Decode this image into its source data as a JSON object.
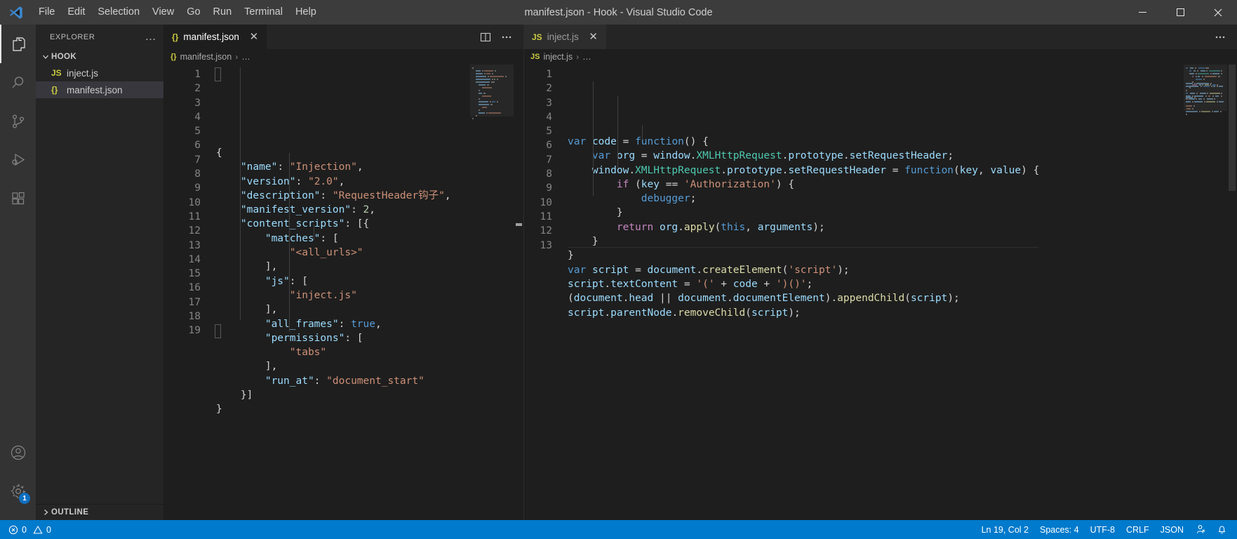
{
  "window": {
    "title": "manifest.json - Hook - Visual Studio Code",
    "logo": "vscode-logo",
    "controls": {
      "minimize": "minimize-icon",
      "maximize": "maximize-icon",
      "close": "close-icon"
    }
  },
  "menubar": {
    "items": [
      {
        "label": "File"
      },
      {
        "label": "Edit"
      },
      {
        "label": "Selection"
      },
      {
        "label": "View"
      },
      {
        "label": "Go"
      },
      {
        "label": "Run"
      },
      {
        "label": "Terminal"
      },
      {
        "label": "Help"
      }
    ]
  },
  "activitybar": {
    "items": [
      {
        "name": "explorer",
        "icon": "files-icon",
        "active": true
      },
      {
        "name": "search",
        "icon": "search-icon",
        "active": false
      },
      {
        "name": "source-control",
        "icon": "source-control-icon",
        "active": false
      },
      {
        "name": "run-and-debug",
        "icon": "run-debug-icon",
        "active": false
      },
      {
        "name": "extensions",
        "icon": "extensions-icon",
        "active": false
      }
    ],
    "bottom": [
      {
        "name": "accounts",
        "icon": "account-icon",
        "badge": ""
      },
      {
        "name": "manage",
        "icon": "gear-icon",
        "badge": "1"
      }
    ]
  },
  "sidebar": {
    "title": "EXPLORER",
    "more_actions": "…",
    "folder": {
      "label": "HOOK",
      "expanded": true
    },
    "files": [
      {
        "label": "inject.js",
        "icon": "JS",
        "icon_type": "js",
        "selected": false
      },
      {
        "label": "manifest.json",
        "icon": "{}",
        "icon_type": "json",
        "selected": true
      }
    ],
    "outline": {
      "label": "OUTLINE",
      "expanded": false
    }
  },
  "editors": [
    {
      "id": "left",
      "tab": {
        "label": "manifest.json",
        "icon": "{}",
        "close": "✕",
        "active": true
      },
      "actions": [
        {
          "name": "split-editor-button",
          "icon": "split-editor-icon"
        },
        {
          "name": "editor-more-actions-button",
          "icon": "ellipsis-icon"
        }
      ],
      "breadcrumb": {
        "icon": "{}",
        "file": "manifest.json",
        "separator": "›",
        "trail": "…"
      },
      "line_count": 19,
      "code": [
        [
          {
            "t": "punc",
            "v": "{"
          }
        ],
        [
          {
            "t": "plain",
            "v": "    "
          },
          {
            "t": "key",
            "v": "\"name\""
          },
          {
            "t": "punc",
            "v": ": "
          },
          {
            "t": "str",
            "v": "\"Injection\""
          },
          {
            "t": "punc",
            "v": ","
          }
        ],
        [
          {
            "t": "plain",
            "v": "    "
          },
          {
            "t": "key",
            "v": "\"version\""
          },
          {
            "t": "punc",
            "v": ": "
          },
          {
            "t": "str",
            "v": "\"2.0\""
          },
          {
            "t": "punc",
            "v": ","
          }
        ],
        [
          {
            "t": "plain",
            "v": "    "
          },
          {
            "t": "key",
            "v": "\"description\""
          },
          {
            "t": "punc",
            "v": ": "
          },
          {
            "t": "str",
            "v": "\"RequestHeader钩子\""
          },
          {
            "t": "punc",
            "v": ","
          }
        ],
        [
          {
            "t": "plain",
            "v": "    "
          },
          {
            "t": "key",
            "v": "\"manifest_version\""
          },
          {
            "t": "punc",
            "v": ": "
          },
          {
            "t": "num",
            "v": "2"
          },
          {
            "t": "punc",
            "v": ","
          }
        ],
        [
          {
            "t": "plain",
            "v": "    "
          },
          {
            "t": "key",
            "v": "\"content_scripts\""
          },
          {
            "t": "punc",
            "v": ": [{"
          }
        ],
        [
          {
            "t": "plain",
            "v": "        "
          },
          {
            "t": "key",
            "v": "\"matches\""
          },
          {
            "t": "punc",
            "v": ": ["
          }
        ],
        [
          {
            "t": "plain",
            "v": "            "
          },
          {
            "t": "str",
            "v": "\"<all_urls>\""
          }
        ],
        [
          {
            "t": "plain",
            "v": "        "
          },
          {
            "t": "punc",
            "v": "],"
          }
        ],
        [
          {
            "t": "plain",
            "v": "        "
          },
          {
            "t": "key",
            "v": "\"js\""
          },
          {
            "t": "punc",
            "v": ": ["
          }
        ],
        [
          {
            "t": "plain",
            "v": "            "
          },
          {
            "t": "str",
            "v": "\"inject.js\""
          }
        ],
        [
          {
            "t": "plain",
            "v": "        "
          },
          {
            "t": "punc",
            "v": "],"
          }
        ],
        [
          {
            "t": "plain",
            "v": "        "
          },
          {
            "t": "key",
            "v": "\"all_frames\""
          },
          {
            "t": "punc",
            "v": ": "
          },
          {
            "t": "bool",
            "v": "true"
          },
          {
            "t": "punc",
            "v": ","
          }
        ],
        [
          {
            "t": "plain",
            "v": "        "
          },
          {
            "t": "key",
            "v": "\"permissions\""
          },
          {
            "t": "punc",
            "v": ": ["
          }
        ],
        [
          {
            "t": "plain",
            "v": "            "
          },
          {
            "t": "str",
            "v": "\"tabs\""
          }
        ],
        [
          {
            "t": "plain",
            "v": "        "
          },
          {
            "t": "punc",
            "v": "],"
          }
        ],
        [
          {
            "t": "plain",
            "v": "        "
          },
          {
            "t": "key",
            "v": "\"run_at\""
          },
          {
            "t": "punc",
            "v": ": "
          },
          {
            "t": "str",
            "v": "\"document_start\""
          }
        ],
        [
          {
            "t": "plain",
            "v": "    "
          },
          {
            "t": "punc",
            "v": "}]"
          }
        ],
        [
          {
            "t": "punc",
            "v": "}"
          }
        ]
      ]
    },
    {
      "id": "right",
      "tab": {
        "label": "inject.js",
        "icon": "JS",
        "close": "✕",
        "active": false
      },
      "actions": [
        {
          "name": "editor-more-actions-button",
          "icon": "ellipsis-icon"
        }
      ],
      "breadcrumb": {
        "icon": "JS",
        "file": "inject.js",
        "separator": "›",
        "trail": "…"
      },
      "line_count": 13,
      "code": [
        [
          {
            "t": "kw",
            "v": "var"
          },
          {
            "t": "plain",
            "v": " "
          },
          {
            "t": "var",
            "v": "code"
          },
          {
            "t": "plain",
            "v": " "
          },
          {
            "t": "punc",
            "v": "="
          },
          {
            "t": "plain",
            "v": " "
          },
          {
            "t": "kw",
            "v": "function"
          },
          {
            "t": "punc",
            "v": "() {"
          }
        ],
        [
          {
            "t": "plain",
            "v": "    "
          },
          {
            "t": "kw",
            "v": "var"
          },
          {
            "t": "plain",
            "v": " "
          },
          {
            "t": "var",
            "v": "org"
          },
          {
            "t": "plain",
            "v": " "
          },
          {
            "t": "punc",
            "v": "="
          },
          {
            "t": "plain",
            "v": " "
          },
          {
            "t": "var",
            "v": "window"
          },
          {
            "t": "punc",
            "v": "."
          },
          {
            "t": "cls",
            "v": "XMLHttpRequest"
          },
          {
            "t": "punc",
            "v": "."
          },
          {
            "t": "var",
            "v": "prototype"
          },
          {
            "t": "punc",
            "v": "."
          },
          {
            "t": "var",
            "v": "setRequestHeader"
          },
          {
            "t": "punc",
            "v": ";"
          }
        ],
        [
          {
            "t": "plain",
            "v": "    "
          },
          {
            "t": "var",
            "v": "window"
          },
          {
            "t": "punc",
            "v": "."
          },
          {
            "t": "cls",
            "v": "XMLHttpRequest"
          },
          {
            "t": "punc",
            "v": "."
          },
          {
            "t": "var",
            "v": "prototype"
          },
          {
            "t": "punc",
            "v": "."
          },
          {
            "t": "var",
            "v": "setRequestHeader"
          },
          {
            "t": "plain",
            "v": " "
          },
          {
            "t": "punc",
            "v": "="
          },
          {
            "t": "plain",
            "v": " "
          },
          {
            "t": "kw",
            "v": "function"
          },
          {
            "t": "punc",
            "v": "("
          },
          {
            "t": "var",
            "v": "key"
          },
          {
            "t": "punc",
            "v": ", "
          },
          {
            "t": "var",
            "v": "value"
          },
          {
            "t": "punc",
            "v": ") {"
          }
        ],
        [
          {
            "t": "plain",
            "v": "        "
          },
          {
            "t": "kw2",
            "v": "if"
          },
          {
            "t": "plain",
            "v": " "
          },
          {
            "t": "punc",
            "v": "("
          },
          {
            "t": "var",
            "v": "key"
          },
          {
            "t": "plain",
            "v": " "
          },
          {
            "t": "punc",
            "v": "=="
          },
          {
            "t": "plain",
            "v": " "
          },
          {
            "t": "str",
            "v": "'Authorization'"
          },
          {
            "t": "punc",
            "v": ") {"
          }
        ],
        [
          {
            "t": "plain",
            "v": "            "
          },
          {
            "t": "kw",
            "v": "debugger"
          },
          {
            "t": "punc",
            "v": ";"
          }
        ],
        [
          {
            "t": "plain",
            "v": "        "
          },
          {
            "t": "punc",
            "v": "}"
          }
        ],
        [
          {
            "t": "plain",
            "v": "        "
          },
          {
            "t": "kw2",
            "v": "return"
          },
          {
            "t": "plain",
            "v": " "
          },
          {
            "t": "var",
            "v": "org"
          },
          {
            "t": "punc",
            "v": "."
          },
          {
            "t": "fn",
            "v": "apply"
          },
          {
            "t": "punc",
            "v": "("
          },
          {
            "t": "kw",
            "v": "this"
          },
          {
            "t": "punc",
            "v": ", "
          },
          {
            "t": "var",
            "v": "arguments"
          },
          {
            "t": "punc",
            "v": ");"
          }
        ],
        [
          {
            "t": "plain",
            "v": "    "
          },
          {
            "t": "punc",
            "v": "}"
          }
        ],
        [
          {
            "t": "punc",
            "v": "}"
          }
        ],
        [
          {
            "t": "kw",
            "v": "var"
          },
          {
            "t": "plain",
            "v": " "
          },
          {
            "t": "var",
            "v": "script"
          },
          {
            "t": "plain",
            "v": " "
          },
          {
            "t": "punc",
            "v": "="
          },
          {
            "t": "plain",
            "v": " "
          },
          {
            "t": "var",
            "v": "document"
          },
          {
            "t": "punc",
            "v": "."
          },
          {
            "t": "fn",
            "v": "createElement"
          },
          {
            "t": "punc",
            "v": "("
          },
          {
            "t": "str",
            "v": "'script'"
          },
          {
            "t": "punc",
            "v": ");"
          }
        ],
        [
          {
            "t": "var",
            "v": "script"
          },
          {
            "t": "punc",
            "v": "."
          },
          {
            "t": "var",
            "v": "textContent"
          },
          {
            "t": "plain",
            "v": " "
          },
          {
            "t": "punc",
            "v": "="
          },
          {
            "t": "plain",
            "v": " "
          },
          {
            "t": "str",
            "v": "'('"
          },
          {
            "t": "plain",
            "v": " "
          },
          {
            "t": "punc",
            "v": "+"
          },
          {
            "t": "plain",
            "v": " "
          },
          {
            "t": "var",
            "v": "code"
          },
          {
            "t": "plain",
            "v": " "
          },
          {
            "t": "punc",
            "v": "+"
          },
          {
            "t": "plain",
            "v": " "
          },
          {
            "t": "str",
            "v": "')()'"
          },
          {
            "t": "punc",
            "v": ";"
          }
        ],
        [
          {
            "t": "punc",
            "v": "("
          },
          {
            "t": "var",
            "v": "document"
          },
          {
            "t": "punc",
            "v": "."
          },
          {
            "t": "var",
            "v": "head"
          },
          {
            "t": "plain",
            "v": " "
          },
          {
            "t": "punc",
            "v": "||"
          },
          {
            "t": "plain",
            "v": " "
          },
          {
            "t": "var",
            "v": "document"
          },
          {
            "t": "punc",
            "v": "."
          },
          {
            "t": "var",
            "v": "documentElement"
          },
          {
            "t": "punc",
            "v": ")."
          },
          {
            "t": "fn",
            "v": "appendChild"
          },
          {
            "t": "punc",
            "v": "("
          },
          {
            "t": "var",
            "v": "script"
          },
          {
            "t": "punc",
            "v": ");"
          }
        ],
        [
          {
            "t": "var",
            "v": "script"
          },
          {
            "t": "punc",
            "v": "."
          },
          {
            "t": "var",
            "v": "parentNode"
          },
          {
            "t": "punc",
            "v": "."
          },
          {
            "t": "fn",
            "v": "removeChild"
          },
          {
            "t": "punc",
            "v": "("
          },
          {
            "t": "var",
            "v": "script"
          },
          {
            "t": "punc",
            "v": ");"
          }
        ]
      ]
    }
  ],
  "statusbar": {
    "left": [
      {
        "name": "problems",
        "icon": "error-icon",
        "errors": "0",
        "warn_icon": "warning-icon",
        "warnings": "0"
      }
    ],
    "right": [
      {
        "name": "cursor-position",
        "label": "Ln 19, Col 2"
      },
      {
        "name": "indentation",
        "label": "Spaces: 4"
      },
      {
        "name": "encoding",
        "label": "UTF-8"
      },
      {
        "name": "eol",
        "label": "CRLF"
      },
      {
        "name": "language-mode",
        "label": "JSON"
      },
      {
        "name": "live-share",
        "icon": "live-share-icon"
      },
      {
        "name": "notifications",
        "icon": "bell-icon"
      }
    ]
  },
  "colors": {
    "titlebar_bg": "#3c3c3c",
    "activitybar_bg": "#333333",
    "sidebar_bg": "#252526",
    "editor_bg": "#1e1e1e",
    "statusbar_bg": "#007acc",
    "accent": "#0e70c0"
  }
}
